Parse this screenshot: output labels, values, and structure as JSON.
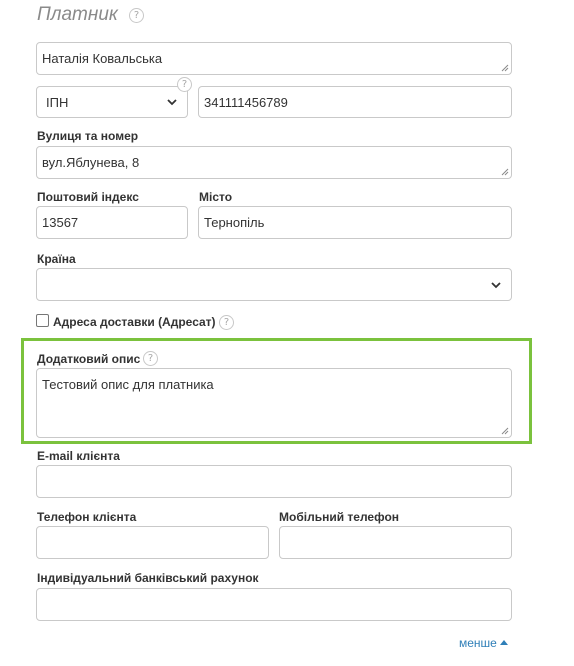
{
  "section": {
    "title": "Платник",
    "help_glyph": "?"
  },
  "payer": {
    "name_value": "Наталія Ковальська",
    "id_type_selected": "ІПН",
    "id_value": "341111456789",
    "street_label": "Вулиця та номер",
    "street_value": "вул.Яблунева, 8",
    "postal_label": "Поштовий індекс",
    "postal_value": "13567",
    "city_label": "Місто",
    "city_value": "Тернопіль",
    "country_label": "Країна",
    "country_value": "",
    "delivery_address_label": "Адреса доставки (Адресат)",
    "delivery_address_checked": false,
    "extra_desc_label": "Додатковий опис",
    "extra_desc_value": "Тестовий опис для платника",
    "email_label": "E-mail клієнта",
    "email_value": "",
    "phone_label": "Телефон клієнта",
    "phone_value": "",
    "mobile_label": "Мобільний телефон",
    "mobile_value": "",
    "bank_account_label": "Індивідуальний банківський рахунок",
    "bank_account_value": ""
  },
  "footer": {
    "less_link": "менше"
  },
  "colors": {
    "highlight": "#7bc23d",
    "link": "#2f7fb8",
    "border": "#c9c9c9"
  },
  "icons": {
    "help": "question-circle-icon",
    "select": "chevron-down-icon",
    "resize": "resize-grip-icon",
    "less": "caret-up-icon"
  }
}
